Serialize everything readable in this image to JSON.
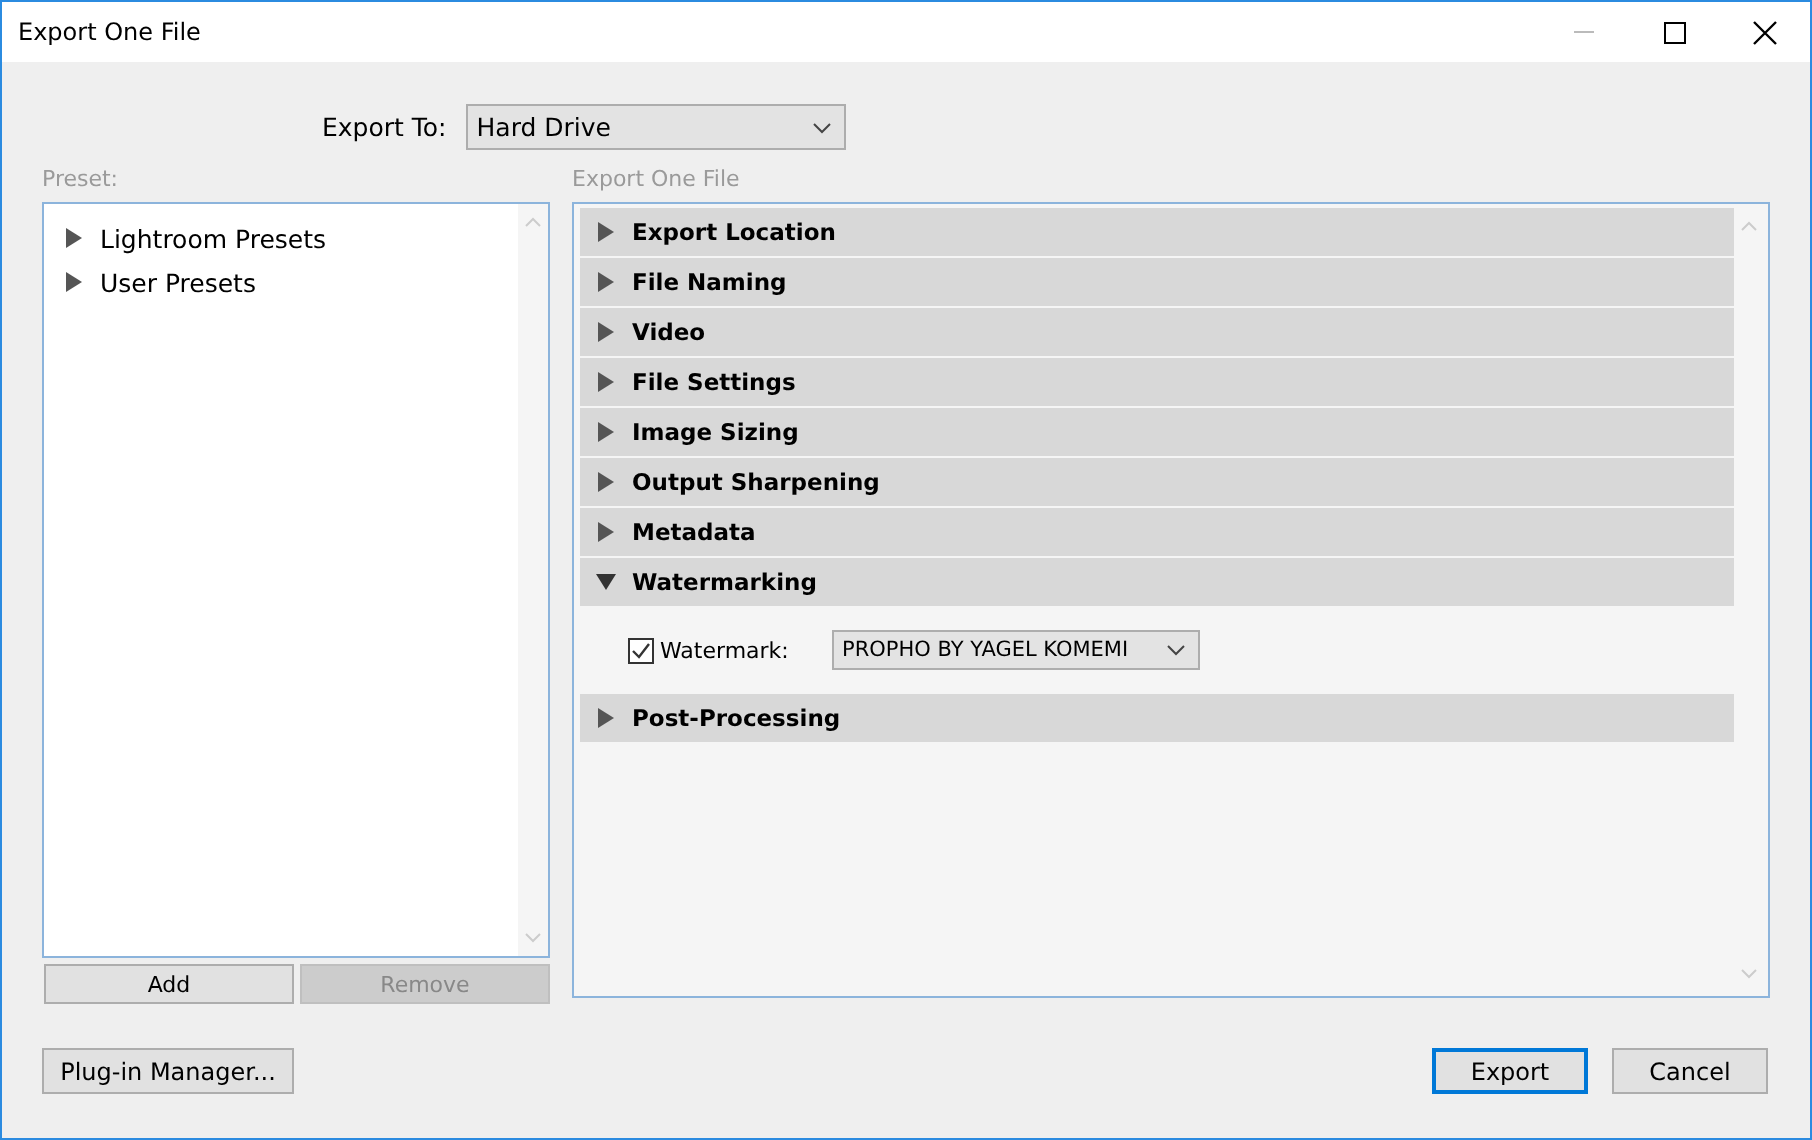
{
  "window": {
    "title": "Export One File",
    "controls": [
      {
        "kind": "minimize",
        "disabled": true
      },
      {
        "kind": "maximize",
        "disabled": false
      },
      {
        "kind": "close",
        "disabled": false
      }
    ]
  },
  "export_to": {
    "label": "Export To:",
    "value": "Hard Drive"
  },
  "preset": {
    "label": "Preset:",
    "items": [
      {
        "label": "Lightroom Presets",
        "expanded": false
      },
      {
        "label": "User Presets",
        "expanded": false
      }
    ],
    "buttons": [
      {
        "label": "Add",
        "disabled": false
      },
      {
        "label": "Remove",
        "disabled": true
      }
    ]
  },
  "settings": {
    "label": "Export One File",
    "sections": [
      {
        "title": "Export Location",
        "expanded": false
      },
      {
        "title": "File Naming",
        "expanded": false
      },
      {
        "title": "Video",
        "expanded": false
      },
      {
        "title": "File Settings",
        "expanded": false
      },
      {
        "title": "Image Sizing",
        "expanded": false
      },
      {
        "title": "Output Sharpening",
        "expanded": false
      },
      {
        "title": "Metadata",
        "expanded": false
      },
      {
        "title": "Watermarking",
        "expanded": true,
        "watermark": {
          "label": "Watermark:",
          "checked": true,
          "value": "PROPHO BY YAGEL KOMEMI"
        }
      },
      {
        "title": "Post-Processing",
        "expanded": false
      }
    ]
  },
  "footer": {
    "left": [
      {
        "label": "Plug-in Manager...",
        "default": false
      }
    ],
    "right": [
      {
        "label": "Export",
        "default": true
      },
      {
        "label": "Cancel",
        "default": false
      }
    ]
  }
}
